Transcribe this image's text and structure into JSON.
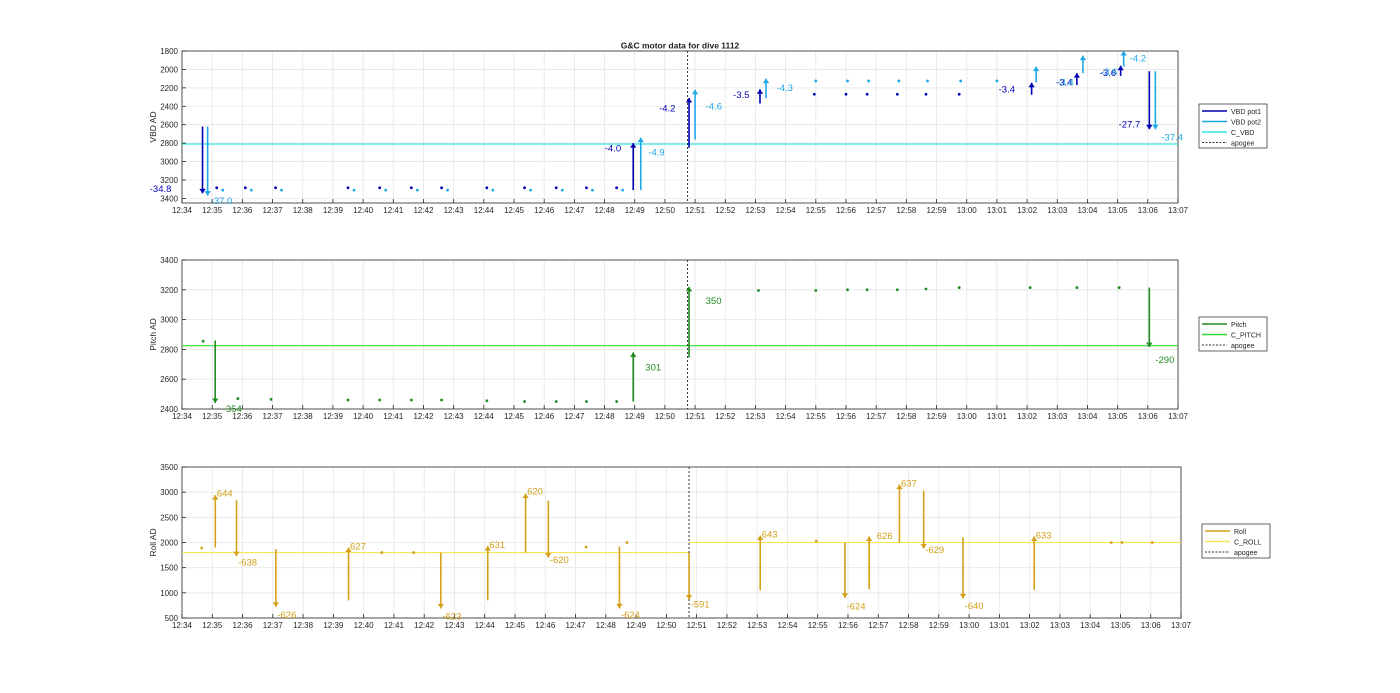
{
  "figure": {
    "title": "G&C motor data for dive 1112"
  },
  "x_ticks": [
    "12:34",
    "12:35",
    "12:36",
    "12:37",
    "12:38",
    "12:39",
    "12:40",
    "12:41",
    "12:42",
    "12:43",
    "12:44",
    "12:45",
    "12:46",
    "12:47",
    "12:48",
    "12:49",
    "12:50",
    "12:51",
    "12:52",
    "12:53",
    "12:54",
    "12:55",
    "12:56",
    "12:57",
    "12:58",
    "12:59",
    "13:00",
    "13:01",
    "13:02",
    "13:03",
    "13:04",
    "13:05",
    "13:06",
    "13:07"
  ],
  "chart_data": [
    {
      "type": "line",
      "title": "G&C motor data for dive 1112",
      "xlabel": "",
      "ylabel": "VBD AD",
      "xlim": [
        "12:34",
        "13:07"
      ],
      "ylim": [
        1800,
        3450
      ],
      "y_reversed": true,
      "yticks": [
        1800,
        2000,
        2200,
        2400,
        2600,
        2800,
        3000,
        3200,
        3400
      ],
      "grid": true,
      "legend": [
        "VBD pot1",
        "VBD pot2",
        "C_VBD",
        "apogee"
      ],
      "legend_position": "right",
      "colors": {
        "pot1": "#0000b4",
        "pot2": "#1fa8e6",
        "ref": "#2ee5e5",
        "apogee": "#333333"
      },
      "apogee": 50.75,
      "ref_value": 2810,
      "dots1": [
        [
          1.15,
          3285
        ],
        [
          2.1,
          3285
        ],
        [
          3.1,
          3285
        ],
        [
          5.5,
          3285
        ],
        [
          6.55,
          3285
        ],
        [
          7.6,
          3285
        ],
        [
          8.6,
          3285
        ],
        [
          10.1,
          3285
        ],
        [
          11.35,
          3285
        ],
        [
          12.4,
          3285
        ],
        [
          13.4,
          3285
        ],
        [
          14.4,
          3285
        ],
        [
          20.95,
          2270
        ],
        [
          22.0,
          2270
        ],
        [
          22.7,
          2270
        ],
        [
          23.7,
          2270
        ],
        [
          24.65,
          2270
        ],
        [
          25.75,
          2270
        ]
      ],
      "dots2": [
        [
          1.35,
          3310
        ],
        [
          2.3,
          3310
        ],
        [
          3.3,
          3310
        ],
        [
          5.7,
          3310
        ],
        [
          6.75,
          3310
        ],
        [
          7.8,
          3310
        ],
        [
          8.8,
          3310
        ],
        [
          10.3,
          3310
        ],
        [
          11.55,
          3310
        ],
        [
          12.6,
          3310
        ],
        [
          13.6,
          3310
        ],
        [
          14.6,
          3310
        ],
        [
          21.0,
          2125
        ],
        [
          22.05,
          2125
        ],
        [
          22.75,
          2125
        ],
        [
          23.75,
          2125
        ],
        [
          24.7,
          2125
        ],
        [
          25.8,
          2125
        ],
        [
          27.0,
          2125
        ]
      ],
      "arrows1": [
        {
          "t": 0.68,
          "y0": 2620,
          "y1": 3345,
          "label": "-34.8",
          "lt": -0.35,
          "ly": 3300,
          "anchor": "end"
        },
        {
          "t": 14.95,
          "y0": 3310,
          "y1": 2800,
          "label": "-4.0",
          "lt": 14.55,
          "ly": 2860,
          "anchor": "end"
        },
        {
          "t": 16.8,
          "y0": 2850,
          "y1": 2310,
          "label": "-4.2",
          "lt": 16.35,
          "ly": 2425,
          "anchor": "end"
        },
        {
          "t": 19.15,
          "y0": 2370,
          "y1": 2215,
          "label": "-3.5",
          "lt": 18.8,
          "ly": 2275,
          "anchor": "end"
        },
        {
          "t": 28.15,
          "y0": 2275,
          "y1": 2145,
          "label": "-3.4",
          "lt": 27.6,
          "ly": 2220,
          "anchor": "end"
        },
        {
          "t": 29.65,
          "y0": 2170,
          "y1": 2040,
          "label": "-3.4",
          "lt": 29.5,
          "ly": 2140,
          "anchor": "end"
        },
        {
          "t": 31.1,
          "y0": 2070,
          "y1": 1960,
          "label": "-3.6",
          "lt": 30.95,
          "ly": 2040,
          "anchor": "end"
        },
        {
          "t": 32.05,
          "y0": 2020,
          "y1": 2650,
          "label": "-27.7",
          "lt": 31.75,
          "ly": 2600,
          "anchor": "end"
        }
      ],
      "arrows2": [
        {
          "t": 0.85,
          "y0": 2620,
          "y1": 3370,
          "label": "-37.0",
          "lt": 0.95,
          "ly": 3430,
          "anchor": "start"
        },
        {
          "t": 15.2,
          "y0": 3310,
          "y1": 2740,
          "label": "-4.9",
          "lt": 15.45,
          "ly": 2900,
          "anchor": "start"
        },
        {
          "t": 17.0,
          "y0": 2760,
          "y1": 2220,
          "label": "-4.6",
          "lt": 17.35,
          "ly": 2405,
          "anchor": "start"
        },
        {
          "t": 19.35,
          "y0": 2310,
          "y1": 2100,
          "label": "-4.3",
          "lt": 19.7,
          "ly": 2200,
          "anchor": "start"
        },
        {
          "t": 28.3,
          "y0": 2140,
          "y1": 1970,
          "label": "-3.4",
          "lt": 29.0,
          "ly": 2140,
          "anchor": "start"
        },
        {
          "t": 29.85,
          "y0": 2040,
          "y1": 1850,
          "label": "-3.6",
          "lt": 30.45,
          "ly": 2030,
          "anchor": "start"
        },
        {
          "t": 31.2,
          "y0": 1970,
          "y1": 1800,
          "label": "-4.2",
          "lt": 31.4,
          "ly": 1880,
          "anchor": "start"
        },
        {
          "t": 32.25,
          "y0": 2020,
          "y1": 2650,
          "label": "-37.4",
          "lt": 32.45,
          "ly": 2740,
          "anchor": "start"
        }
      ]
    },
    {
      "type": "line",
      "xlabel": "",
      "ylabel": "Pitch AD",
      "xlim": [
        "12:34",
        "13:07"
      ],
      "ylim": [
        2400,
        3400
      ],
      "yticks": [
        2400,
        2600,
        2800,
        3000,
        3200,
        3400
      ],
      "grid": true,
      "legend": [
        "Pitch",
        "C_PITCH",
        "apogee"
      ],
      "legend_position": "right",
      "colors": {
        "series": "#228b22",
        "ref": "#33dd33",
        "apogee": "#333333"
      },
      "apogee": 50.75,
      "ref_value": 2825,
      "dots": [
        [
          0.7,
          2855
        ],
        [
          1.85,
          2470
        ],
        [
          2.95,
          2465
        ],
        [
          5.5,
          2460
        ],
        [
          6.55,
          2460
        ],
        [
          7.6,
          2460
        ],
        [
          8.6,
          2460
        ],
        [
          10.1,
          2455
        ],
        [
          11.35,
          2450
        ],
        [
          12.4,
          2450
        ],
        [
          13.4,
          2450
        ],
        [
          14.4,
          2450
        ],
        [
          19.1,
          3195
        ],
        [
          21.0,
          3195
        ],
        [
          22.05,
          3200
        ],
        [
          22.7,
          3200
        ],
        [
          23.7,
          3200
        ],
        [
          24.65,
          3205
        ],
        [
          25.75,
          3215
        ],
        [
          28.1,
          3215
        ],
        [
          29.65,
          3215
        ],
        [
          31.05,
          3215
        ]
      ],
      "arrows": [
        {
          "t": 1.1,
          "y0": 2860,
          "y1": 2440,
          "label": "-354",
          "lt": 1.35,
          "ly": 2400,
          "anchor": "start"
        },
        {
          "t": 14.95,
          "y0": 2450,
          "y1": 2780,
          "label": "301",
          "lt": 15.35,
          "ly": 2680,
          "anchor": "start"
        },
        {
          "t": 16.8,
          "y0": 2745,
          "y1": 3220,
          "label": "350",
          "lt": 17.35,
          "ly": 3125,
          "anchor": "start"
        },
        {
          "t": 32.05,
          "y0": 3215,
          "y1": 2815,
          "label": "-290",
          "lt": 32.25,
          "ly": 2730,
          "anchor": "start"
        }
      ]
    },
    {
      "type": "line",
      "xlabel": "",
      "ylabel": "Roll AD",
      "xlim": [
        "12:34",
        "13:07"
      ],
      "ylim": [
        500,
        3500
      ],
      "yticks": [
        500,
        1000,
        1500,
        2000,
        2500,
        3000,
        3500
      ],
      "grid": true,
      "legend": [
        "Roll",
        "C_ROLL",
        "apogee"
      ],
      "legend_position": "right",
      "colors": {
        "series": "#d4a018",
        "ref": "#f5e65a",
        "apogee": "#333333"
      },
      "apogee": 50.75,
      "ref_before": 1800,
      "ref_after": 2000,
      "dots": [
        [
          0.65,
          1890
        ],
        [
          6.6,
          1800
        ],
        [
          7.65,
          1800
        ],
        [
          13.35,
          1910
        ],
        [
          14.7,
          2000
        ],
        [
          20.95,
          2030
        ],
        [
          30.7,
          2000
        ],
        [
          32.05,
          2000
        ],
        [
          31.05,
          2000
        ]
      ],
      "arrows": [
        {
          "t": 1.1,
          "y0": 1900,
          "y1": 2940,
          "label": "644",
          "lt": 1.15,
          "ly": 2970,
          "anchor": "start"
        },
        {
          "t": 1.8,
          "y0": 2840,
          "y1": 1730,
          "label": "-638",
          "lt": 1.85,
          "ly": 1600,
          "anchor": "start"
        },
        {
          "t": 3.1,
          "y0": 1870,
          "y1": 720,
          "label": "-626",
          "lt": 3.15,
          "ly": 560,
          "anchor": "start"
        },
        {
          "t": 5.5,
          "y0": 850,
          "y1": 1900,
          "label": "627",
          "lt": 5.55,
          "ly": 1920,
          "anchor": "start"
        },
        {
          "t": 8.55,
          "y0": 1800,
          "y1": 690,
          "label": "-623",
          "lt": 8.6,
          "ly": 530,
          "anchor": "start"
        },
        {
          "t": 10.1,
          "y0": 850,
          "y1": 1930,
          "label": "631",
          "lt": 10.15,
          "ly": 1950,
          "anchor": "start"
        },
        {
          "t": 11.35,
          "y0": 1800,
          "y1": 2970,
          "label": "620",
          "lt": 11.4,
          "ly": 3010,
          "anchor": "start"
        },
        {
          "t": 12.1,
          "y0": 2830,
          "y1": 1700,
          "label": "-620",
          "lt": 12.15,
          "ly": 1650,
          "anchor": "start"
        },
        {
          "t": 14.45,
          "y0": 1920,
          "y1": 690,
          "label": "-624",
          "lt": 14.5,
          "ly": 560,
          "anchor": "start"
        },
        {
          "t": 16.75,
          "y0": 1790,
          "y1": 870,
          "label": "-591",
          "lt": 16.8,
          "ly": 770,
          "anchor": "start"
        },
        {
          "t": 19.1,
          "y0": 1050,
          "y1": 2140,
          "label": "643",
          "lt": 19.15,
          "ly": 2160,
          "anchor": "start"
        },
        {
          "t": 21.9,
          "y0": 2000,
          "y1": 900,
          "label": "-624",
          "lt": 21.95,
          "ly": 730,
          "anchor": "start"
        },
        {
          "t": 22.7,
          "y0": 1070,
          "y1": 2120,
          "label": "626",
          "lt": 22.95,
          "ly": 2130,
          "anchor": "start"
        },
        {
          "t": 23.7,
          "y0": 2000,
          "y1": 3150,
          "label": "637",
          "lt": 23.75,
          "ly": 3170,
          "anchor": "start"
        },
        {
          "t": 24.5,
          "y0": 3030,
          "y1": 1880,
          "label": "-629",
          "lt": 24.55,
          "ly": 1850,
          "anchor": "start"
        },
        {
          "t": 25.8,
          "y0": 2100,
          "y1": 890,
          "label": "-640",
          "lt": 25.85,
          "ly": 740,
          "anchor": "start"
        },
        {
          "t": 28.15,
          "y0": 1060,
          "y1": 2120,
          "label": "633",
          "lt": 28.2,
          "ly": 2140,
          "anchor": "start"
        }
      ]
    }
  ]
}
